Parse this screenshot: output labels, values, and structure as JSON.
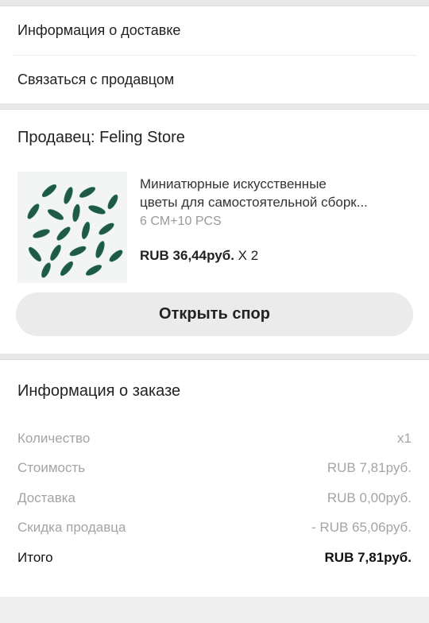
{
  "links": {
    "delivery_info": "Информация о доставке",
    "contact_seller": "Связаться с продавцом"
  },
  "seller": {
    "title": "Продавец: Feling Store"
  },
  "product": {
    "name_line1": "Миниатюрные искусственные",
    "name_line2": "цветы для самостоятельной сборк...",
    "variant": "6 CM+10 PCS",
    "price": "RUB 36,44руб.",
    "qty": "X 2",
    "image": "green-pine-leaves-thumbnail"
  },
  "dispute_button": "Открыть спор",
  "order": {
    "title": "Информация о заказе",
    "rows": [
      {
        "label": "Количество",
        "value": "x1"
      },
      {
        "label": "Стоимость",
        "value": "RUB 7,81руб."
      },
      {
        "label": "Доставка",
        "value": "RUB 0,00руб."
      },
      {
        "label": "Скидка продавца",
        "value": "- RUB 65,06руб."
      }
    ],
    "total_label": "Итого",
    "total_value": "RUB 7,81руб."
  },
  "colors": {
    "background": "#efefef",
    "button": "#ebebeb",
    "muted": "#a4a4a4",
    "leaf": "#1f5a45"
  }
}
